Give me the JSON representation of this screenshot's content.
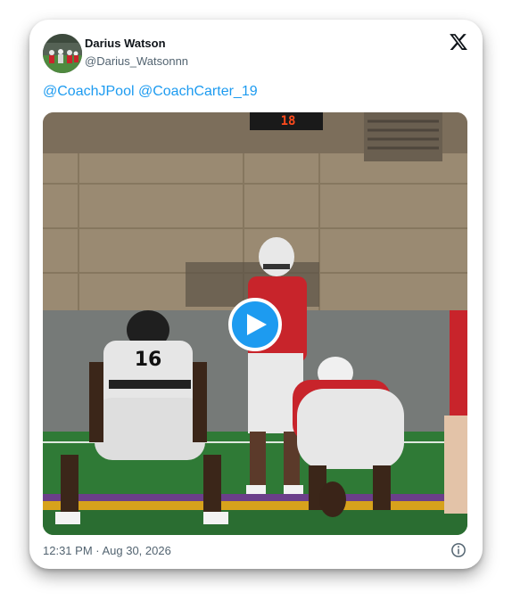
{
  "tweet": {
    "author": {
      "display_name": "Darius Watson",
      "handle": "@Darius_Watsonnn",
      "avatar_icon": "profile-photo-football"
    },
    "mentions": [
      "@CoachJPool",
      "@CoachCarter_19"
    ],
    "media": {
      "type": "video",
      "play_icon": "play-icon",
      "scoreboard_text": "18",
      "jersey_number": "16",
      "accent_color": "#1d9bf0"
    },
    "timestamp": "12:31 PM · Aug 30, 2026",
    "brand_icon": "x-logo-icon",
    "info_icon": "info-icon"
  },
  "colors": {
    "link": "#1d9bf0",
    "text_primary": "#0f1419",
    "text_secondary": "#536471",
    "jersey_red": "#c8242b",
    "field_green": "#2f7a36"
  }
}
